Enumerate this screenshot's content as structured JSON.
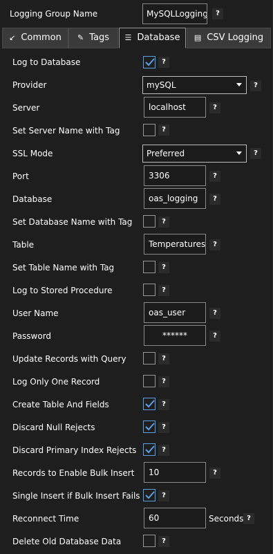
{
  "header": {
    "group_name_label": "Logging Group Name",
    "group_name_value": "MySQLLogging",
    "help": "?"
  },
  "tabs": [
    {
      "label": "Common",
      "icon": "compress-arrow-icon"
    },
    {
      "label": "Tags",
      "icon": "tag-icon"
    },
    {
      "label": "Database",
      "icon": "database-icon",
      "active": true
    },
    {
      "label": "CSV Logging",
      "icon": "csv-file-icon"
    }
  ],
  "fields": {
    "log_to_database": {
      "label": "Log to Database",
      "checked": true
    },
    "provider": {
      "label": "Provider",
      "value": "mySQL"
    },
    "server": {
      "label": "Server",
      "value": "localhost"
    },
    "set_server_name_with_tag": {
      "label": "Set Server Name with Tag",
      "checked": false
    },
    "ssl_mode": {
      "label": "SSL Mode",
      "value": "Preferred"
    },
    "port": {
      "label": "Port",
      "value": "3306"
    },
    "database": {
      "label": "Database",
      "value": "oas_logging"
    },
    "set_database_name_with_tag": {
      "label": "Set Database Name with Tag",
      "checked": false
    },
    "table": {
      "label": "Table",
      "value": "Temperatures"
    },
    "set_table_name_with_tag": {
      "label": "Set Table Name with Tag",
      "checked": false
    },
    "log_to_stored_procedure": {
      "label": "Log to Stored Procedure",
      "checked": false
    },
    "user_name": {
      "label": "User Name",
      "value": "oas_user"
    },
    "password": {
      "label": "Password",
      "value": "******"
    },
    "update_records_with_query": {
      "label": "Update Records with Query",
      "checked": false
    },
    "log_only_one_record": {
      "label": "Log Only One Record",
      "checked": false
    },
    "create_table_and_fields": {
      "label": "Create Table And Fields",
      "checked": true
    },
    "discard_null_rejects": {
      "label": "Discard Null Rejects",
      "checked": true
    },
    "discard_primary_index_rejects": {
      "label": "Discard Primary Index Rejects",
      "checked": true
    },
    "records_to_enable_bulk_insert": {
      "label": "Records to Enable Bulk Insert",
      "value": "10"
    },
    "single_insert_if_bulk_insert_fails": {
      "label": "Single Insert if Bulk Insert Fails",
      "checked": true
    },
    "reconnect_time": {
      "label": "Reconnect Time",
      "value": "60",
      "unit": "Seconds"
    },
    "delete_old_database_data": {
      "label": "Delete Old Database Data",
      "checked": false
    }
  },
  "colors": {
    "background": "#1e1e1e",
    "check_accent": "#5aa0e6",
    "tab_inactive": "#3a3a3a"
  }
}
